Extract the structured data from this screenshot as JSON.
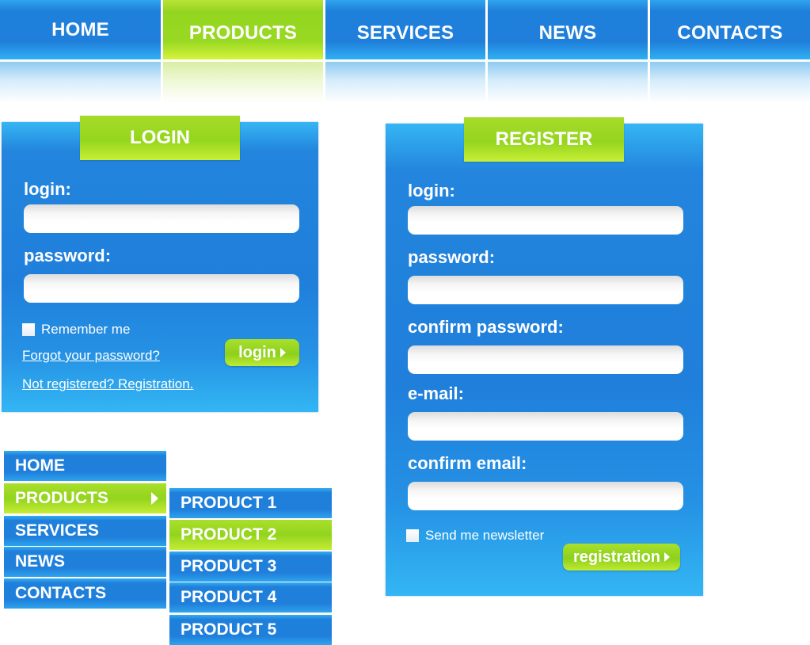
{
  "top_nav": {
    "items": [
      {
        "label": "HOME",
        "active": false
      },
      {
        "label": "PRODUCTS",
        "active": true
      },
      {
        "label": "SERVICES",
        "active": false
      },
      {
        "label": "NEWS",
        "active": false
      },
      {
        "label": "CONTACTS",
        "active": false
      }
    ]
  },
  "login_panel": {
    "title": "LOGIN",
    "login_label": "login:",
    "login_value": "",
    "password_label": "password:",
    "password_value": "",
    "remember_label": "Remember me",
    "remember_checked": false,
    "forgot_link": "Forgot your password?",
    "register_link": "Not registered? Registration.",
    "submit_label": "login",
    "submit_icon": "play-triangle-icon"
  },
  "register_panel": {
    "title": "REGISTER",
    "fields": [
      {
        "label": "login:",
        "value": ""
      },
      {
        "label": "password:",
        "value": ""
      },
      {
        "label": "confirm password:",
        "value": ""
      },
      {
        "label": "e-mail:",
        "value": ""
      },
      {
        "label": "confirm email:",
        "value": ""
      }
    ],
    "newsletter_label": "Send me newsletter",
    "newsletter_checked": false,
    "submit_label": "registration",
    "submit_icon": "play-triangle-icon"
  },
  "side_menu": {
    "items": [
      {
        "label": "HOME",
        "active": false
      },
      {
        "label": "PRODUCTS",
        "active": true,
        "has_submenu": true,
        "icon": "chevron-right-icon"
      },
      {
        "label": "SERVICES",
        "active": false
      },
      {
        "label": "NEWS",
        "active": false
      },
      {
        "label": "CONTACTS",
        "active": false
      }
    ]
  },
  "submenu": {
    "items": [
      {
        "label": "PRODUCT 1",
        "active": false
      },
      {
        "label": "PRODUCT 2",
        "active": true
      },
      {
        "label": "PRODUCT 3",
        "active": false
      },
      {
        "label": "PRODUCT 4",
        "active": false
      },
      {
        "label": "PRODUCT 5",
        "active": false
      }
    ]
  },
  "colors": {
    "primary_blue": "#1f7fdb",
    "accent_green": "#95d51e",
    "text": "#ffffff"
  }
}
